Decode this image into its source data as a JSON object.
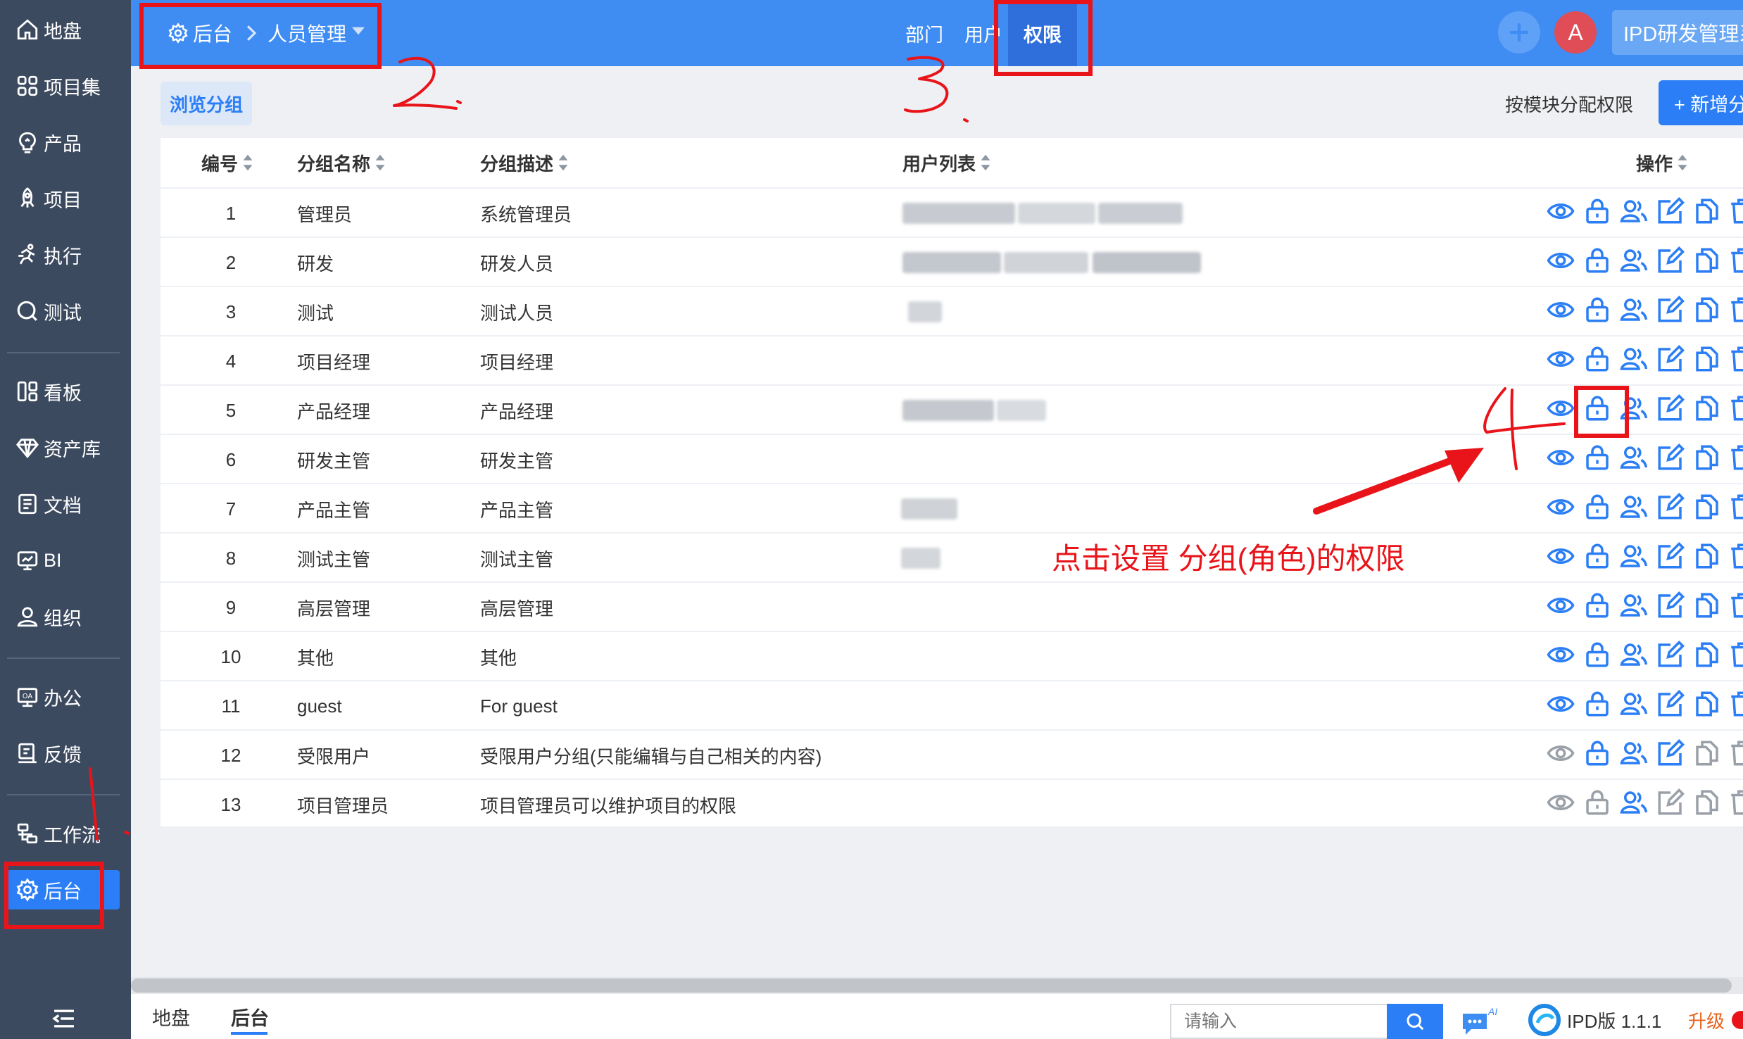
{
  "sidebar": {
    "items": [
      {
        "label": "地盘",
        "icon": "home-icon"
      },
      {
        "label": "项目集",
        "icon": "grid-icon"
      },
      {
        "label": "产品",
        "icon": "lightbulb-icon"
      },
      {
        "label": "项目",
        "icon": "rocket-icon"
      },
      {
        "label": "执行",
        "icon": "run-icon"
      },
      {
        "label": "测试",
        "icon": "search-icon"
      },
      {
        "label": "看板",
        "icon": "kanban-icon"
      },
      {
        "label": "资产库",
        "icon": "diamond-icon"
      },
      {
        "label": "文档",
        "icon": "document-icon"
      },
      {
        "label": "BI",
        "icon": "monitor-icon"
      },
      {
        "label": "组织",
        "icon": "user-icon"
      },
      {
        "label": "办公",
        "icon": "oa-icon"
      },
      {
        "label": "反馈",
        "icon": "feedback-icon"
      },
      {
        "label": "工作流",
        "icon": "workflow-icon"
      },
      {
        "label": "后台",
        "icon": "gear-icon"
      }
    ],
    "active": "后台"
  },
  "topbar": {
    "breadcrumb_root": "后台",
    "breadcrumb_current": "人员管理",
    "tabs": [
      {
        "label": "部门"
      },
      {
        "label": "用户"
      },
      {
        "label": "权限"
      }
    ],
    "active_tab": "权限",
    "avatar_letter": "A",
    "org_name": "IPD研发管理系"
  },
  "subbar": {
    "tab": "浏览分组",
    "module_link": "按模块分配权限",
    "new_button": "+ 新增分"
  },
  "table": {
    "headers": {
      "id": "编号",
      "name": "分组名称",
      "desc": "分组描述",
      "users": "用户列表",
      "actions": "操作"
    },
    "rows": [
      {
        "id": "1",
        "name": "管理员",
        "desc": "系统管理员"
      },
      {
        "id": "2",
        "name": "研发",
        "desc": "研发人员"
      },
      {
        "id": "3",
        "name": "测试",
        "desc": "测试人员"
      },
      {
        "id": "4",
        "name": "项目经理",
        "desc": "项目经理"
      },
      {
        "id": "5",
        "name": "产品经理",
        "desc": "产品经理"
      },
      {
        "id": "6",
        "name": "研发主管",
        "desc": "研发主管"
      },
      {
        "id": "7",
        "name": "产品主管",
        "desc": "产品主管"
      },
      {
        "id": "8",
        "name": "测试主管",
        "desc": "测试主管"
      },
      {
        "id": "9",
        "name": "高层管理",
        "desc": "高层管理"
      },
      {
        "id": "10",
        "name": "其他",
        "desc": "其他"
      },
      {
        "id": "11",
        "name": "guest",
        "desc": "For guest"
      },
      {
        "id": "12",
        "name": "受限用户",
        "desc": "受限用户分组(只能编辑与自己相关的内容)"
      },
      {
        "id": "13",
        "name": "项目管理员",
        "desc": "项目管理员可以维护项目的权限"
      }
    ],
    "action_icons": [
      "eye-icon",
      "lock-icon",
      "users-icon",
      "edit-icon",
      "copy-icon",
      "trash-icon"
    ]
  },
  "annotations": {
    "note": "点击设置 分组(角色)的权限"
  },
  "footer": {
    "tabs": [
      {
        "label": "地盘"
      },
      {
        "label": "后台"
      }
    ],
    "active_tab": "后台",
    "search_placeholder": "请输入",
    "ai_label": "AI",
    "version": "IPD版 1.1.1",
    "upgrade": "升级"
  },
  "colors": {
    "sidebar_bg": "#3c4a5f",
    "topbar_bg": "#3f8cf3",
    "accent": "#2b7ef5",
    "annotation": "#e8141a"
  }
}
